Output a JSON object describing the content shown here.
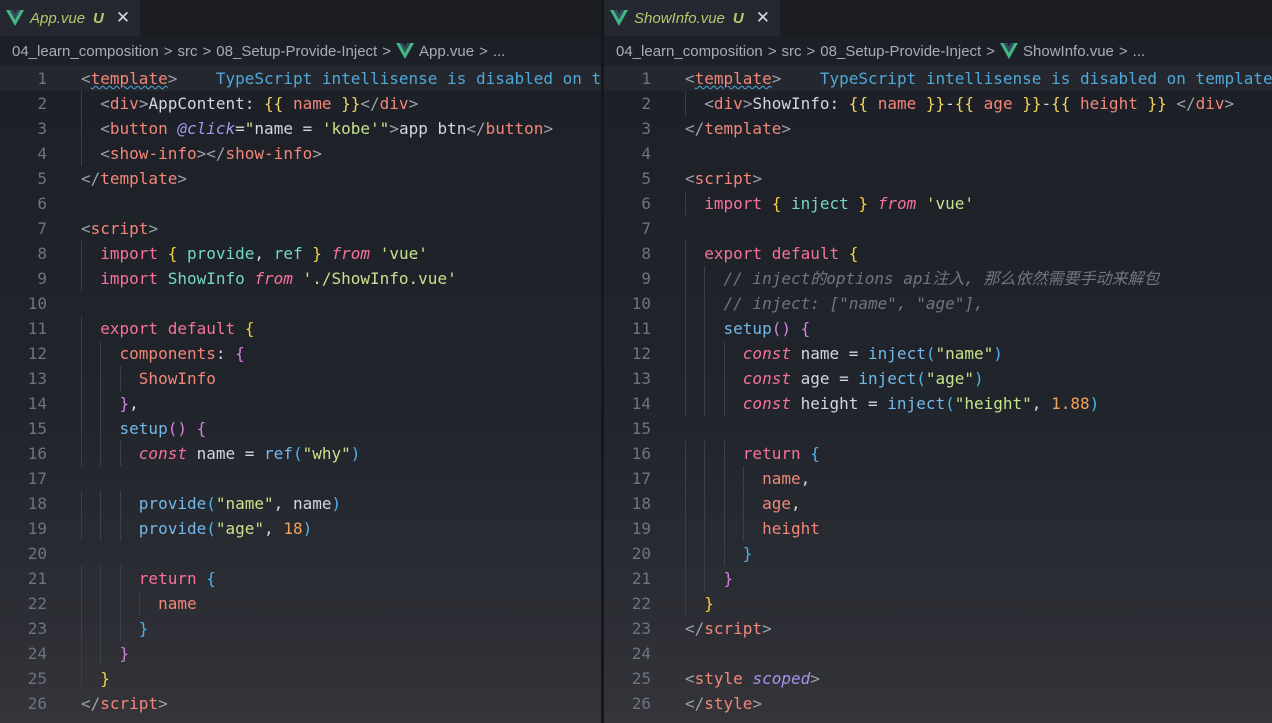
{
  "colors": {
    "vue_logo_outer": "#41b883",
    "vue_logo_inner": "#35495e",
    "tab_filename": "#b4c96d",
    "hint": "#4fa8d8"
  },
  "left": {
    "tab": {
      "filename": "App.vue",
      "status": "U",
      "close": "✕",
      "icon": "vue-icon"
    },
    "breadcrumb": {
      "parts": [
        "04_learn_composition",
        "src",
        "08_Setup-Provide-Inject"
      ],
      "file": "App.vue",
      "more": "...",
      "separator": ">"
    },
    "lines": [
      {
        "n": "1",
        "t": [
          [
            "c-brk",
            "<"
          ],
          [
            "c-tag",
            "template"
          ],
          [
            "c-brk",
            ">"
          ],
          [
            "c-txt",
            "    "
          ],
          [
            "c-hint",
            "TypeScript intellisense is disabled on template."
          ]
        ]
      },
      {
        "n": "2",
        "t": [
          [
            "c-txt",
            "  "
          ],
          [
            "c-brk",
            "<"
          ],
          [
            "c-tag",
            "div"
          ],
          [
            "c-brk",
            ">"
          ],
          [
            "c-txt",
            "AppContent: "
          ],
          [
            "c-mus",
            "{{"
          ],
          [
            "c-txt",
            " "
          ],
          [
            "c-var",
            "name"
          ],
          [
            "c-txt",
            " "
          ],
          [
            "c-mus",
            "}}"
          ],
          [
            "c-brk",
            "</"
          ],
          [
            "c-tag",
            "div"
          ],
          [
            "c-brk",
            ">"
          ]
        ]
      },
      {
        "n": "3",
        "t": [
          [
            "c-txt",
            "  "
          ],
          [
            "c-brk",
            "<"
          ],
          [
            "c-tag",
            "button"
          ],
          [
            "c-txt",
            " "
          ],
          [
            "c-attr",
            "@click"
          ],
          [
            "c-txt",
            "="
          ],
          [
            "c-str",
            "\""
          ],
          [
            "c-txt",
            "name = "
          ],
          [
            "c-str",
            "'kobe'"
          ],
          [
            "c-str",
            "\""
          ],
          [
            "c-brk",
            ">"
          ],
          [
            "c-txt",
            "app btn"
          ],
          [
            "c-brk",
            "</"
          ],
          [
            "c-tag",
            "button"
          ],
          [
            "c-brk",
            ">"
          ]
        ]
      },
      {
        "n": "4",
        "t": [
          [
            "c-txt",
            "  "
          ],
          [
            "c-brk",
            "<"
          ],
          [
            "c-tag",
            "show-info"
          ],
          [
            "c-brk",
            "></"
          ],
          [
            "c-tag",
            "show-info"
          ],
          [
            "c-brk",
            ">"
          ]
        ]
      },
      {
        "n": "5",
        "t": [
          [
            "c-brk",
            "</"
          ],
          [
            "c-tag",
            "template"
          ],
          [
            "c-brk",
            ">"
          ]
        ]
      },
      {
        "n": "6",
        "t": []
      },
      {
        "n": "7",
        "t": [
          [
            "c-brk",
            "<"
          ],
          [
            "c-tag",
            "script"
          ],
          [
            "c-brk",
            ">"
          ]
        ]
      },
      {
        "n": "8",
        "t": [
          [
            "c-txt",
            "  "
          ],
          [
            "c-kw",
            "import"
          ],
          [
            "c-txt",
            " "
          ],
          [
            "c-b1",
            "{"
          ],
          [
            "c-txt",
            " "
          ],
          [
            "c-cls",
            "provide"
          ],
          [
            "c-txt",
            ", "
          ],
          [
            "c-cls",
            "ref"
          ],
          [
            "c-txt",
            " "
          ],
          [
            "c-b1",
            "}"
          ],
          [
            "c-txt",
            " "
          ],
          [
            "c-from",
            "from"
          ],
          [
            "c-txt",
            " "
          ],
          [
            "c-str",
            "'vue'"
          ]
        ]
      },
      {
        "n": "9",
        "t": [
          [
            "c-txt",
            "  "
          ],
          [
            "c-kw",
            "import"
          ],
          [
            "c-txt",
            " "
          ],
          [
            "c-cls",
            "ShowInfo"
          ],
          [
            "c-txt",
            " "
          ],
          [
            "c-from",
            "from"
          ],
          [
            "c-txt",
            " "
          ],
          [
            "c-str",
            "'./ShowInfo.vue'"
          ]
        ]
      },
      {
        "n": "10",
        "t": []
      },
      {
        "n": "11",
        "t": [
          [
            "c-txt",
            "  "
          ],
          [
            "c-kw",
            "export"
          ],
          [
            "c-txt",
            " "
          ],
          [
            "c-kw",
            "default"
          ],
          [
            "c-txt",
            " "
          ],
          [
            "c-b1",
            "{"
          ]
        ]
      },
      {
        "n": "12",
        "t": [
          [
            "c-txt",
            "    "
          ],
          [
            "c-prop",
            "components"
          ],
          [
            "c-txt",
            ": "
          ],
          [
            "c-b2",
            "{"
          ]
        ]
      },
      {
        "n": "13",
        "t": [
          [
            "c-txt",
            "      "
          ],
          [
            "c-prop",
            "ShowInfo"
          ]
        ]
      },
      {
        "n": "14",
        "t": [
          [
            "c-txt",
            "    "
          ],
          [
            "c-b2",
            "}"
          ],
          [
            "c-txt",
            ","
          ]
        ]
      },
      {
        "n": "15",
        "t": [
          [
            "c-txt",
            "    "
          ],
          [
            "c-fn",
            "setup"
          ],
          [
            "c-b2",
            "()"
          ],
          [
            "c-txt",
            " "
          ],
          [
            "c-b2",
            "{"
          ]
        ]
      },
      {
        "n": "16",
        "t": [
          [
            "c-txt",
            "      "
          ],
          [
            "c-const",
            "const"
          ],
          [
            "c-txt",
            " name = "
          ],
          [
            "c-fn",
            "ref"
          ],
          [
            "c-b3",
            "("
          ],
          [
            "c-str",
            "\"why\""
          ],
          [
            "c-b3",
            ")"
          ]
        ]
      },
      {
        "n": "17",
        "t": []
      },
      {
        "n": "18",
        "t": [
          [
            "c-txt",
            "      "
          ],
          [
            "c-fn",
            "provide"
          ],
          [
            "c-b3",
            "("
          ],
          [
            "c-str",
            "\"name\""
          ],
          [
            "c-txt",
            ", name"
          ],
          [
            "c-b3",
            ")"
          ]
        ]
      },
      {
        "n": "19",
        "t": [
          [
            "c-txt",
            "      "
          ],
          [
            "c-fn",
            "provide"
          ],
          [
            "c-b3",
            "("
          ],
          [
            "c-str",
            "\"age\""
          ],
          [
            "c-txt",
            ", "
          ],
          [
            "c-num",
            "18"
          ],
          [
            "c-b3",
            ")"
          ]
        ]
      },
      {
        "n": "20",
        "t": []
      },
      {
        "n": "21",
        "t": [
          [
            "c-txt",
            "      "
          ],
          [
            "c-kw",
            "return"
          ],
          [
            "c-txt",
            " "
          ],
          [
            "c-b3",
            "{"
          ]
        ]
      },
      {
        "n": "22",
        "t": [
          [
            "c-txt",
            "        "
          ],
          [
            "c-prop",
            "name"
          ]
        ]
      },
      {
        "n": "23",
        "t": [
          [
            "c-txt",
            "      "
          ],
          [
            "c-b3",
            "}"
          ]
        ]
      },
      {
        "n": "24",
        "t": [
          [
            "c-txt",
            "    "
          ],
          [
            "c-b2",
            "}"
          ]
        ]
      },
      {
        "n": "25",
        "t": [
          [
            "c-txt",
            "  "
          ],
          [
            "c-b1",
            "}"
          ]
        ]
      },
      {
        "n": "26",
        "t": [
          [
            "c-brk",
            "</"
          ],
          [
            "c-tag",
            "script"
          ],
          [
            "c-brk",
            ">"
          ]
        ]
      }
    ]
  },
  "right": {
    "tab": {
      "filename": "ShowInfo.vue",
      "status": "U",
      "close": "✕",
      "icon": "vue-icon"
    },
    "breadcrumb": {
      "parts": [
        "04_learn_composition",
        "src",
        "08_Setup-Provide-Inject"
      ],
      "file": "ShowInfo.vue",
      "more": "...",
      "separator": ">"
    },
    "lines": [
      {
        "n": "1",
        "t": [
          [
            "c-brk",
            "<"
          ],
          [
            "c-tag",
            "template"
          ],
          [
            "c-brk",
            ">"
          ],
          [
            "c-txt",
            "    "
          ],
          [
            "c-hint",
            "TypeScript intellisense is disabled on template."
          ]
        ]
      },
      {
        "n": "2",
        "t": [
          [
            "c-txt",
            "  "
          ],
          [
            "c-brk",
            "<"
          ],
          [
            "c-tag",
            "div"
          ],
          [
            "c-brk",
            ">"
          ],
          [
            "c-txt",
            "ShowInfo: "
          ],
          [
            "c-mus",
            "{{"
          ],
          [
            "c-txt",
            " "
          ],
          [
            "c-var",
            "name"
          ],
          [
            "c-txt",
            " "
          ],
          [
            "c-mus",
            "}}"
          ],
          [
            "c-txt",
            "-"
          ],
          [
            "c-mus",
            "{{"
          ],
          [
            "c-txt",
            " "
          ],
          [
            "c-var",
            "age"
          ],
          [
            "c-txt",
            " "
          ],
          [
            "c-mus",
            "}}"
          ],
          [
            "c-txt",
            "-"
          ],
          [
            "c-mus",
            "{{"
          ],
          [
            "c-txt",
            " "
          ],
          [
            "c-var",
            "height"
          ],
          [
            "c-txt",
            " "
          ],
          [
            "c-mus",
            "}}"
          ],
          [
            "c-txt",
            " "
          ],
          [
            "c-brk",
            "</"
          ],
          [
            "c-tag",
            "div"
          ],
          [
            "c-brk",
            ">"
          ]
        ]
      },
      {
        "n": "3",
        "t": [
          [
            "c-brk",
            "</"
          ],
          [
            "c-tag",
            "template"
          ],
          [
            "c-brk",
            ">"
          ]
        ]
      },
      {
        "n": "4",
        "t": []
      },
      {
        "n": "5",
        "t": [
          [
            "c-brk",
            "<"
          ],
          [
            "c-tag",
            "script"
          ],
          [
            "c-brk",
            ">"
          ]
        ]
      },
      {
        "n": "6",
        "t": [
          [
            "c-txt",
            "  "
          ],
          [
            "c-kw",
            "import"
          ],
          [
            "c-txt",
            " "
          ],
          [
            "c-b1",
            "{"
          ],
          [
            "c-txt",
            " "
          ],
          [
            "c-cls",
            "inject"
          ],
          [
            "c-txt",
            " "
          ],
          [
            "c-b1",
            "}"
          ],
          [
            "c-txt",
            " "
          ],
          [
            "c-from",
            "from"
          ],
          [
            "c-txt",
            " "
          ],
          [
            "c-str",
            "'vue'"
          ]
        ]
      },
      {
        "n": "7",
        "t": []
      },
      {
        "n": "8",
        "t": [
          [
            "c-txt",
            "  "
          ],
          [
            "c-kw",
            "export"
          ],
          [
            "c-txt",
            " "
          ],
          [
            "c-kw",
            "default"
          ],
          [
            "c-txt",
            " "
          ],
          [
            "c-b1",
            "{"
          ]
        ]
      },
      {
        "n": "9",
        "t": [
          [
            "c-txt",
            "    "
          ],
          [
            "c-cmt",
            "// inject的options api注入, 那么依然需要手动来解包"
          ]
        ]
      },
      {
        "n": "10",
        "t": [
          [
            "c-txt",
            "    "
          ],
          [
            "c-cmt",
            "// inject: [\"name\", \"age\"],"
          ]
        ]
      },
      {
        "n": "11",
        "t": [
          [
            "c-txt",
            "    "
          ],
          [
            "c-fn",
            "setup"
          ],
          [
            "c-b2",
            "()"
          ],
          [
            "c-txt",
            " "
          ],
          [
            "c-b2",
            "{"
          ]
        ]
      },
      {
        "n": "12",
        "t": [
          [
            "c-txt",
            "      "
          ],
          [
            "c-const",
            "const"
          ],
          [
            "c-txt",
            " name = "
          ],
          [
            "c-fn",
            "inject"
          ],
          [
            "c-b3",
            "("
          ],
          [
            "c-str",
            "\"name\""
          ],
          [
            "c-b3",
            ")"
          ]
        ]
      },
      {
        "n": "13",
        "t": [
          [
            "c-txt",
            "      "
          ],
          [
            "c-const",
            "const"
          ],
          [
            "c-txt",
            " age = "
          ],
          [
            "c-fn",
            "inject"
          ],
          [
            "c-b3",
            "("
          ],
          [
            "c-str",
            "\"age\""
          ],
          [
            "c-b3",
            ")"
          ]
        ]
      },
      {
        "n": "14",
        "t": [
          [
            "c-txt",
            "      "
          ],
          [
            "c-const",
            "const"
          ],
          [
            "c-txt",
            " height = "
          ],
          [
            "c-fn",
            "inject"
          ],
          [
            "c-b3",
            "("
          ],
          [
            "c-str",
            "\"height\""
          ],
          [
            "c-txt",
            ", "
          ],
          [
            "c-num",
            "1.88"
          ],
          [
            "c-b3",
            ")"
          ]
        ]
      },
      {
        "n": "15",
        "t": []
      },
      {
        "n": "16",
        "t": [
          [
            "c-txt",
            "      "
          ],
          [
            "c-kw",
            "return"
          ],
          [
            "c-txt",
            " "
          ],
          [
            "c-b3",
            "{"
          ]
        ]
      },
      {
        "n": "17",
        "t": [
          [
            "c-txt",
            "        "
          ],
          [
            "c-prop",
            "name"
          ],
          [
            "c-txt",
            ","
          ]
        ]
      },
      {
        "n": "18",
        "t": [
          [
            "c-txt",
            "        "
          ],
          [
            "c-prop",
            "age"
          ],
          [
            "c-txt",
            ","
          ]
        ]
      },
      {
        "n": "19",
        "t": [
          [
            "c-txt",
            "        "
          ],
          [
            "c-prop",
            "height"
          ]
        ]
      },
      {
        "n": "20",
        "t": [
          [
            "c-txt",
            "      "
          ],
          [
            "c-b3",
            "}"
          ]
        ]
      },
      {
        "n": "21",
        "t": [
          [
            "c-txt",
            "    "
          ],
          [
            "c-b2",
            "}"
          ]
        ]
      },
      {
        "n": "22",
        "t": [
          [
            "c-txt",
            "  "
          ],
          [
            "c-b1",
            "}"
          ]
        ]
      },
      {
        "n": "23",
        "t": [
          [
            "c-brk",
            "</"
          ],
          [
            "c-tag",
            "script"
          ],
          [
            "c-brk",
            ">"
          ]
        ]
      },
      {
        "n": "24",
        "t": []
      },
      {
        "n": "25",
        "t": [
          [
            "c-brk",
            "<"
          ],
          [
            "c-tag",
            "style"
          ],
          [
            "c-txt",
            " "
          ],
          [
            "c-attr",
            "scoped"
          ],
          [
            "c-brk",
            ">"
          ]
        ]
      },
      {
        "n": "26",
        "t": [
          [
            "c-brk",
            "</"
          ],
          [
            "c-tag",
            "style"
          ],
          [
            "c-brk",
            ">"
          ]
        ]
      }
    ]
  }
}
